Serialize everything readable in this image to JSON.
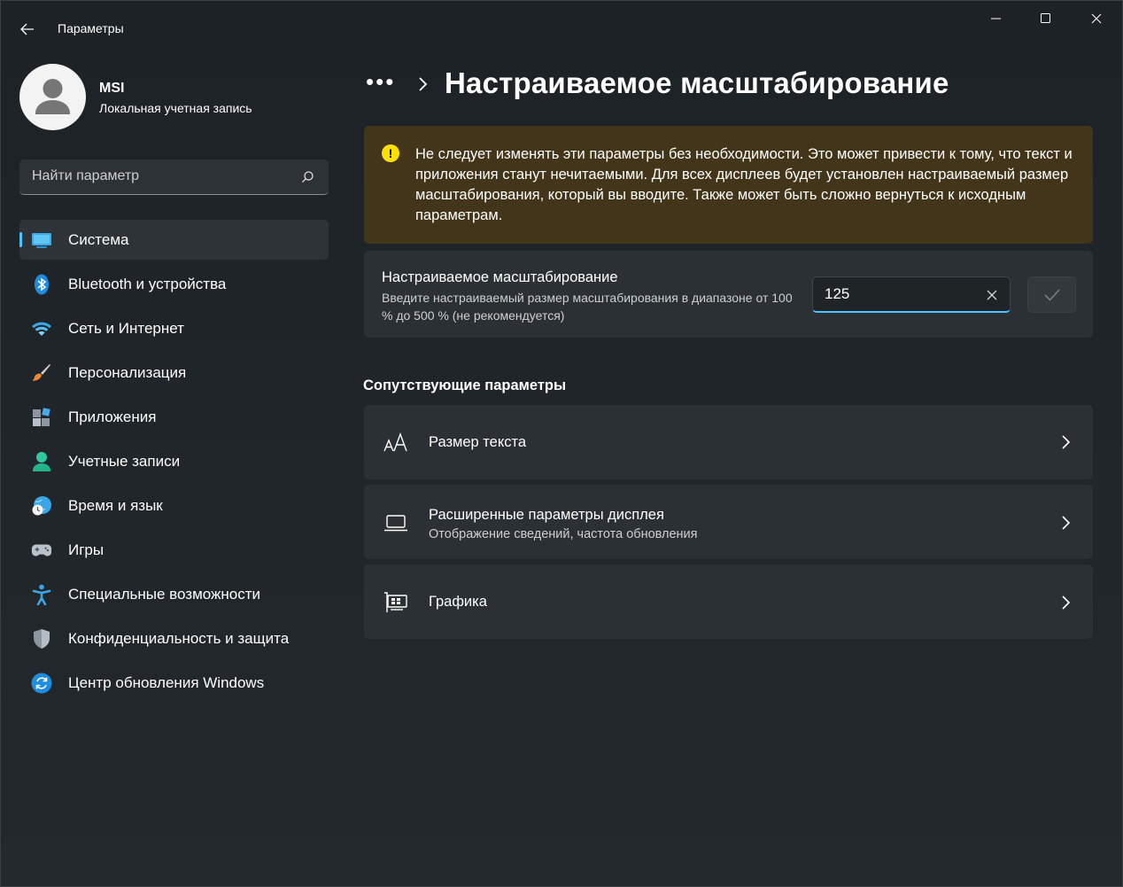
{
  "window": {
    "title": "Параметры"
  },
  "profile": {
    "name": "MSI",
    "account_type": "Локальная учетная запись"
  },
  "search": {
    "placeholder": "Найти параметр"
  },
  "sidebar": {
    "items": [
      {
        "label": "Система",
        "icon": "system-display-icon",
        "selected": true
      },
      {
        "label": "Bluetooth и устройства",
        "icon": "bluetooth-icon"
      },
      {
        "label": "Сеть и Интернет",
        "icon": "wifi-icon"
      },
      {
        "label": "Персонализация",
        "icon": "brush-icon"
      },
      {
        "label": "Приложения",
        "icon": "apps-icon"
      },
      {
        "label": "Учетные записи",
        "icon": "person-icon"
      },
      {
        "label": "Время и язык",
        "icon": "globe-clock-icon"
      },
      {
        "label": "Игры",
        "icon": "gamepad-icon"
      },
      {
        "label": "Специальные возможности",
        "icon": "accessibility-icon"
      },
      {
        "label": "Конфиденциальность и защита",
        "icon": "shield-icon"
      },
      {
        "label": "Центр обновления Windows",
        "icon": "update-icon"
      }
    ]
  },
  "main": {
    "breadcrumb_dots": "•••",
    "title": "Настраиваемое масштабирование",
    "warning": "Не следует изменять эти параметры без необходимости. Это может привести к тому, что текст и приложения станут нечитаемыми. Для всех дисплеев будет установлен настраиваемый размер масштабирования, который вы вводите. Также может быть сложно вернуться к исходным параметрам.",
    "scaling": {
      "title": "Настраиваемое масштабирование",
      "description": "Введите настраиваемый размер масштабирования в диапазоне от 100 % до 500 % (не рекомендуется)",
      "value": "125"
    },
    "related_heading": "Сопутствующие параметры",
    "related": [
      {
        "title": "Размер текста",
        "subtitle": "",
        "icon": "text-size-icon"
      },
      {
        "title": "Расширенные параметры дисплея",
        "subtitle": "Отображение сведений, частота обновления",
        "icon": "laptop-icon"
      },
      {
        "title": "Графика",
        "subtitle": "",
        "icon": "graphics-card-icon"
      }
    ]
  },
  "colors": {
    "accent": "#4cc2ff",
    "warning_bg": "#433519",
    "warning_icon": "#fce100",
    "card_bg": "#2a3034"
  }
}
